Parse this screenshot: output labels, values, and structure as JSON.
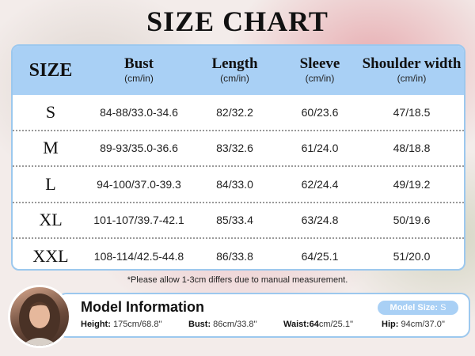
{
  "title": "SIZE CHART",
  "table": {
    "headers": [
      {
        "label": "SIZE",
        "unit": ""
      },
      {
        "label": "Bust",
        "unit": "(cm/in)"
      },
      {
        "label": "Length",
        "unit": "(cm/in)"
      },
      {
        "label": "Sleeve",
        "unit": "(cm/in)"
      },
      {
        "label": "Shoulder width",
        "unit": "(cm/in)"
      }
    ],
    "rows": [
      {
        "size": "S",
        "bust": "84-88/33.0-34.6",
        "length": "82/32.2",
        "sleeve": "60/23.6",
        "shoulder": "47/18.5"
      },
      {
        "size": "M",
        "bust": "89-93/35.0-36.6",
        "length": "83/32.6",
        "sleeve": "61/24.0",
        "shoulder": "48/18.8"
      },
      {
        "size": "L",
        "bust": "94-100/37.0-39.3",
        "length": "84/33.0",
        "sleeve": "62/24.4",
        "shoulder": "49/19.2"
      },
      {
        "size": "XL",
        "bust": "101-107/39.7-42.1",
        "length": "85/33.4",
        "sleeve": "63/24.8",
        "shoulder": "50/19.6"
      },
      {
        "size": "XXL",
        "bust": "108-114/42.5-44.8",
        "length": "86/33.8",
        "sleeve": "64/25.1",
        "shoulder": "51/20.0"
      }
    ]
  },
  "footnote": "*Please allow 1-3cm differs due to manual measurement.",
  "model": {
    "title": "Model Information",
    "size_label": "Model Size:",
    "size_value": "S",
    "height_label": "Height:",
    "height_value": "175cm/68.8''",
    "bust_label": "Bust:",
    "bust_value": "86cm/33.8''",
    "waist_label": "Waist:64",
    "waist_value": "cm/25.1''",
    "hip_label": "Hip:",
    "hip_value": "94cm/37.0''"
  },
  "colors": {
    "accent": "#a9d0f5",
    "border": "#9cc8ee"
  }
}
